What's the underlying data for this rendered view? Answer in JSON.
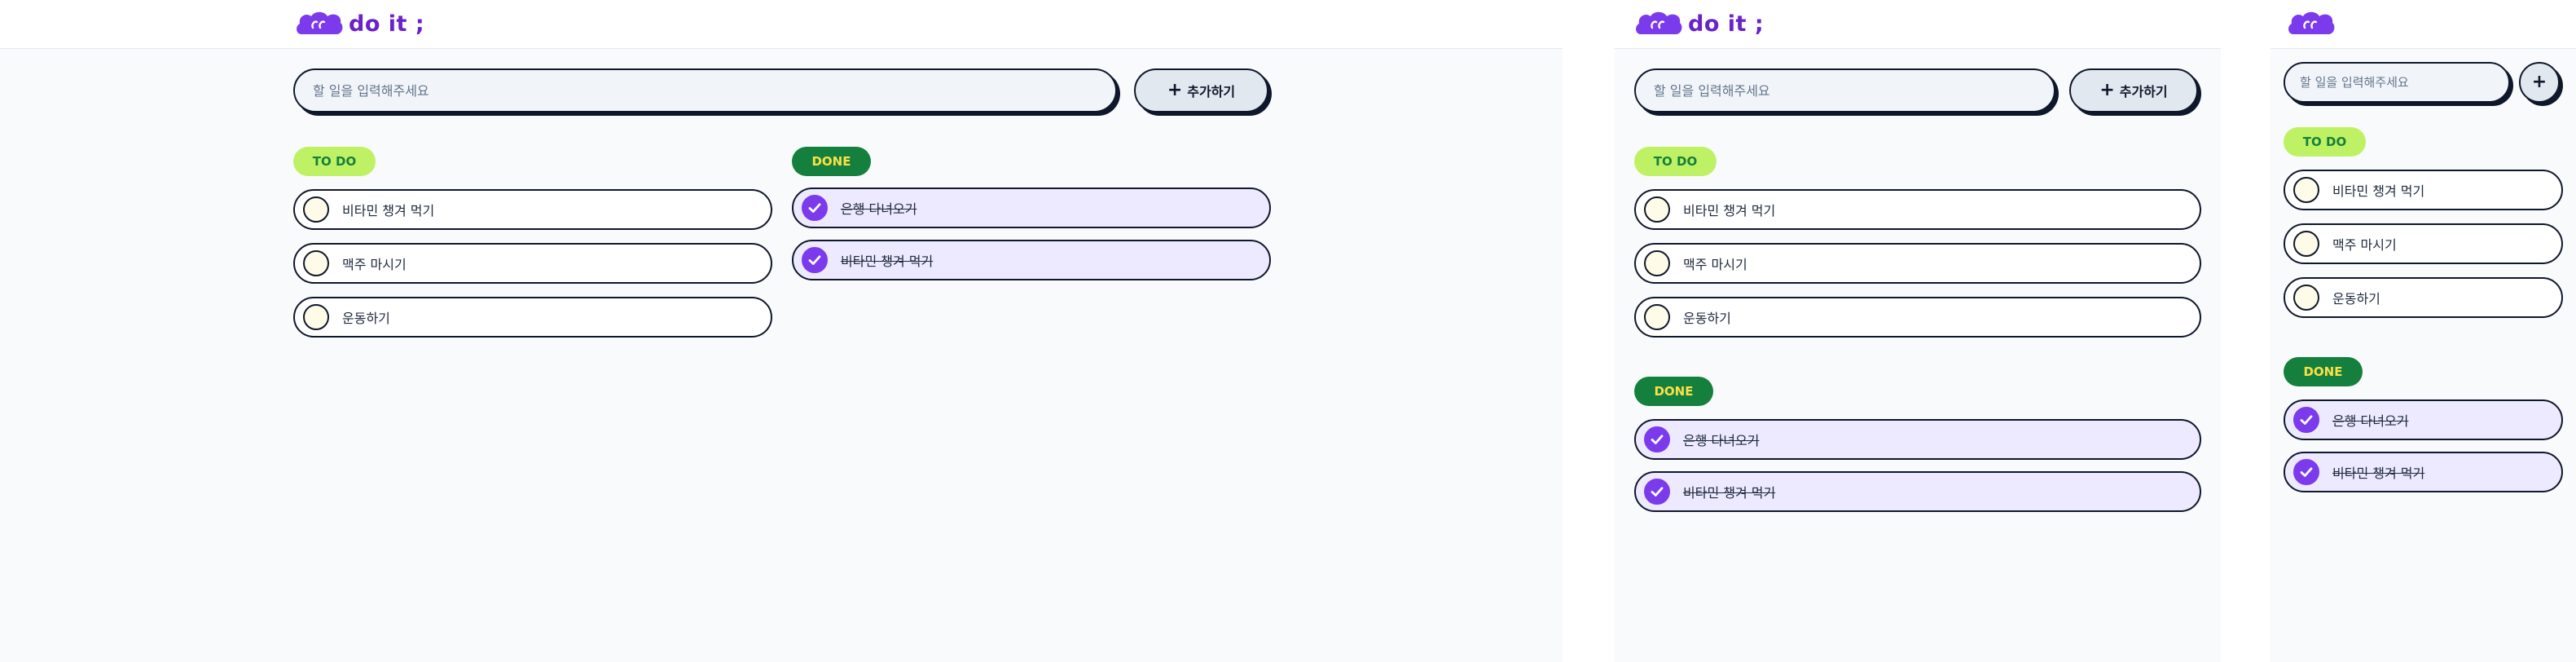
{
  "app": {
    "logo_text": "do it ;",
    "search_placeholder": "할 일을 입력해주세요",
    "add_button_label": "추가하기",
    "add_button_icon": "plus-icon",
    "todo_label": "TO DO",
    "done_label": "DONE",
    "todo_items": [
      {
        "label": "비타민 챙겨 먹기"
      },
      {
        "label": "맥주 마시기"
      },
      {
        "label": "운동하기"
      }
    ],
    "done_items": [
      {
        "label": "은행 다녀오기"
      },
      {
        "label": "비타민 챙겨 먹기"
      }
    ]
  },
  "colors": {
    "brand_purple": "#6b21c8",
    "todo_badge_bg": "#bef264",
    "todo_badge_text": "#15803d",
    "done_badge_bg": "#15803d",
    "done_badge_text": "#fde047",
    "done_item_bg": "#ede9fe",
    "check_purple": "#7c3aed"
  },
  "icons": {
    "logo": "cloud-eyes-logo-icon",
    "unchecked": "unchecked-circle-icon",
    "checked": "checked-circle-icon"
  }
}
